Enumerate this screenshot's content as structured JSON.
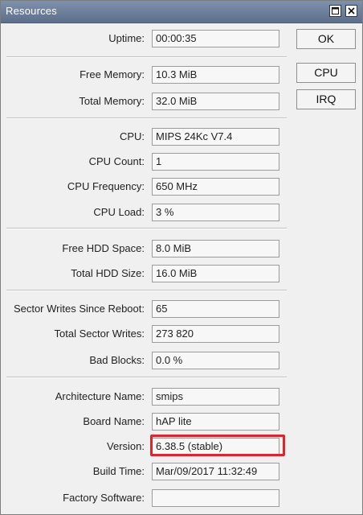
{
  "window": {
    "title": "Resources"
  },
  "buttons": {
    "ok": "OK",
    "cpu": "CPU",
    "irq": "IRQ"
  },
  "fields": [
    {
      "label": "Uptime:",
      "value": "00:00:35"
    },
    {
      "label": "Free Memory:",
      "value": "10.3 MiB"
    },
    {
      "label": "Total Memory:",
      "value": "32.0 MiB"
    },
    {
      "label": "CPU:",
      "value": "MIPS 24Kc V7.4"
    },
    {
      "label": "CPU Count:",
      "value": "1"
    },
    {
      "label": "CPU Frequency:",
      "value": "650 MHz"
    },
    {
      "label": "CPU Load:",
      "value": "3 %"
    },
    {
      "label": "Free HDD Space:",
      "value": "8.0 MiB"
    },
    {
      "label": "Total HDD Size:",
      "value": "16.0 MiB"
    },
    {
      "label": "Sector Writes Since Reboot:",
      "value": "65"
    },
    {
      "label": "Total Sector Writes:",
      "value": "273 820"
    },
    {
      "label": "Bad Blocks:",
      "value": "0.0 %"
    },
    {
      "label": "Architecture Name:",
      "value": "smips"
    },
    {
      "label": "Board Name:",
      "value": "hAP lite"
    },
    {
      "label": "Version:",
      "value": "6.38.5 (stable)"
    },
    {
      "label": "Build Time:",
      "value": "Mar/09/2017 11:32:49"
    },
    {
      "label": "Factory Software:",
      "value": ""
    }
  ],
  "colors": {
    "titlebar": "#6b7c98",
    "highlight": "#d8282e"
  }
}
